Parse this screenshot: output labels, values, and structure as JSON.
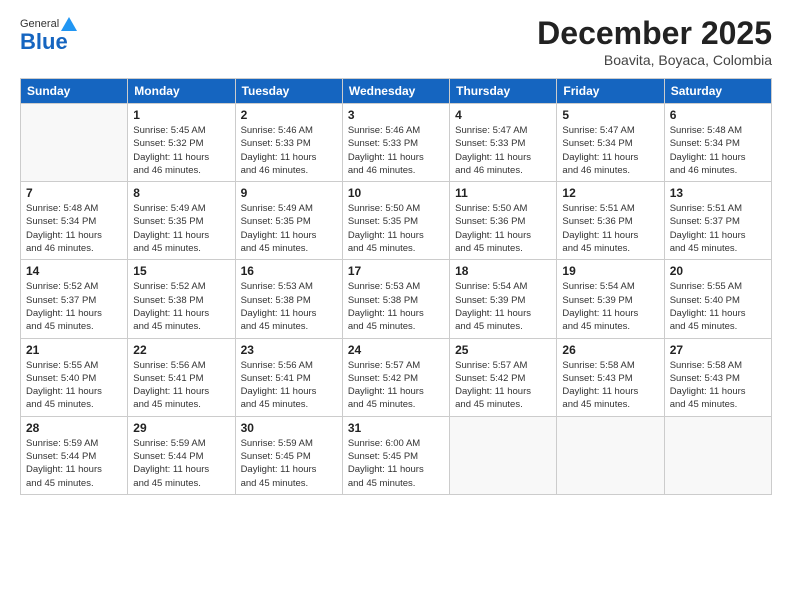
{
  "header": {
    "logo_general": "General",
    "logo_blue": "Blue",
    "month_title": "December 2025",
    "location": "Boavita, Boyaca, Colombia"
  },
  "weekdays": [
    "Sunday",
    "Monday",
    "Tuesday",
    "Wednesday",
    "Thursday",
    "Friday",
    "Saturday"
  ],
  "weeks": [
    [
      {
        "day": "",
        "info": ""
      },
      {
        "day": "1",
        "info": "Sunrise: 5:45 AM\nSunset: 5:32 PM\nDaylight: 11 hours\nand 46 minutes."
      },
      {
        "day": "2",
        "info": "Sunrise: 5:46 AM\nSunset: 5:33 PM\nDaylight: 11 hours\nand 46 minutes."
      },
      {
        "day": "3",
        "info": "Sunrise: 5:46 AM\nSunset: 5:33 PM\nDaylight: 11 hours\nand 46 minutes."
      },
      {
        "day": "4",
        "info": "Sunrise: 5:47 AM\nSunset: 5:33 PM\nDaylight: 11 hours\nand 46 minutes."
      },
      {
        "day": "5",
        "info": "Sunrise: 5:47 AM\nSunset: 5:34 PM\nDaylight: 11 hours\nand 46 minutes."
      },
      {
        "day": "6",
        "info": "Sunrise: 5:48 AM\nSunset: 5:34 PM\nDaylight: 11 hours\nand 46 minutes."
      }
    ],
    [
      {
        "day": "7",
        "info": "Sunrise: 5:48 AM\nSunset: 5:34 PM\nDaylight: 11 hours\nand 46 minutes."
      },
      {
        "day": "8",
        "info": "Sunrise: 5:49 AM\nSunset: 5:35 PM\nDaylight: 11 hours\nand 45 minutes."
      },
      {
        "day": "9",
        "info": "Sunrise: 5:49 AM\nSunset: 5:35 PM\nDaylight: 11 hours\nand 45 minutes."
      },
      {
        "day": "10",
        "info": "Sunrise: 5:50 AM\nSunset: 5:35 PM\nDaylight: 11 hours\nand 45 minutes."
      },
      {
        "day": "11",
        "info": "Sunrise: 5:50 AM\nSunset: 5:36 PM\nDaylight: 11 hours\nand 45 minutes."
      },
      {
        "day": "12",
        "info": "Sunrise: 5:51 AM\nSunset: 5:36 PM\nDaylight: 11 hours\nand 45 minutes."
      },
      {
        "day": "13",
        "info": "Sunrise: 5:51 AM\nSunset: 5:37 PM\nDaylight: 11 hours\nand 45 minutes."
      }
    ],
    [
      {
        "day": "14",
        "info": "Sunrise: 5:52 AM\nSunset: 5:37 PM\nDaylight: 11 hours\nand 45 minutes."
      },
      {
        "day": "15",
        "info": "Sunrise: 5:52 AM\nSunset: 5:38 PM\nDaylight: 11 hours\nand 45 minutes."
      },
      {
        "day": "16",
        "info": "Sunrise: 5:53 AM\nSunset: 5:38 PM\nDaylight: 11 hours\nand 45 minutes."
      },
      {
        "day": "17",
        "info": "Sunrise: 5:53 AM\nSunset: 5:38 PM\nDaylight: 11 hours\nand 45 minutes."
      },
      {
        "day": "18",
        "info": "Sunrise: 5:54 AM\nSunset: 5:39 PM\nDaylight: 11 hours\nand 45 minutes."
      },
      {
        "day": "19",
        "info": "Sunrise: 5:54 AM\nSunset: 5:39 PM\nDaylight: 11 hours\nand 45 minutes."
      },
      {
        "day": "20",
        "info": "Sunrise: 5:55 AM\nSunset: 5:40 PM\nDaylight: 11 hours\nand 45 minutes."
      }
    ],
    [
      {
        "day": "21",
        "info": "Sunrise: 5:55 AM\nSunset: 5:40 PM\nDaylight: 11 hours\nand 45 minutes."
      },
      {
        "day": "22",
        "info": "Sunrise: 5:56 AM\nSunset: 5:41 PM\nDaylight: 11 hours\nand 45 minutes."
      },
      {
        "day": "23",
        "info": "Sunrise: 5:56 AM\nSunset: 5:41 PM\nDaylight: 11 hours\nand 45 minutes."
      },
      {
        "day": "24",
        "info": "Sunrise: 5:57 AM\nSunset: 5:42 PM\nDaylight: 11 hours\nand 45 minutes."
      },
      {
        "day": "25",
        "info": "Sunrise: 5:57 AM\nSunset: 5:42 PM\nDaylight: 11 hours\nand 45 minutes."
      },
      {
        "day": "26",
        "info": "Sunrise: 5:58 AM\nSunset: 5:43 PM\nDaylight: 11 hours\nand 45 minutes."
      },
      {
        "day": "27",
        "info": "Sunrise: 5:58 AM\nSunset: 5:43 PM\nDaylight: 11 hours\nand 45 minutes."
      }
    ],
    [
      {
        "day": "28",
        "info": "Sunrise: 5:59 AM\nSunset: 5:44 PM\nDaylight: 11 hours\nand 45 minutes."
      },
      {
        "day": "29",
        "info": "Sunrise: 5:59 AM\nSunset: 5:44 PM\nDaylight: 11 hours\nand 45 minutes."
      },
      {
        "day": "30",
        "info": "Sunrise: 5:59 AM\nSunset: 5:45 PM\nDaylight: 11 hours\nand 45 minutes."
      },
      {
        "day": "31",
        "info": "Sunrise: 6:00 AM\nSunset: 5:45 PM\nDaylight: 11 hours\nand 45 minutes."
      },
      {
        "day": "",
        "info": ""
      },
      {
        "day": "",
        "info": ""
      },
      {
        "day": "",
        "info": ""
      }
    ]
  ]
}
